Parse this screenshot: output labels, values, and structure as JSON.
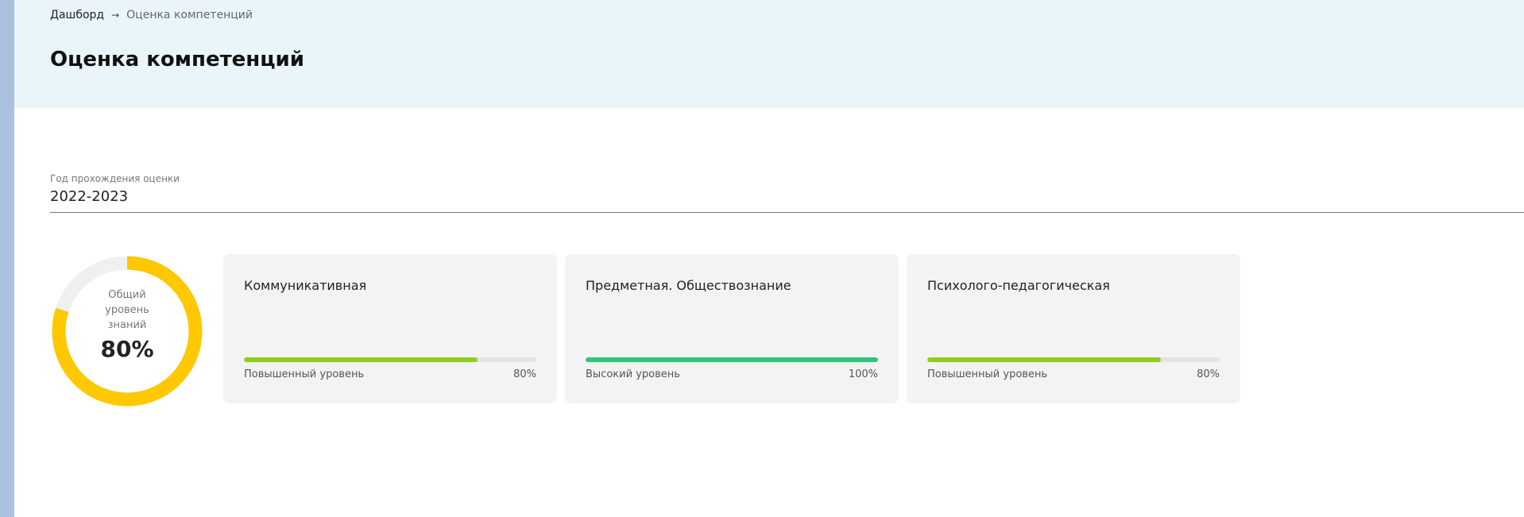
{
  "breadcrumb": {
    "home": "Дашборд",
    "separator": "→",
    "current": "Оценка компетенций"
  },
  "page_title": "Оценка компетенций",
  "year_field": {
    "label": "Год прохождения оценки",
    "value": "2022-2023"
  },
  "overall": {
    "label_line1": "Общий",
    "label_line2": "уровень",
    "label_line3": "знаний",
    "value_text": "80%",
    "progress": 0.8,
    "color": "#ffc800",
    "track_color": "#f0f0f0"
  },
  "cards": [
    {
      "title": "Коммуникативная",
      "level": "Повышенный уровень",
      "percent_text": "80%",
      "progress": 0.8,
      "bar_color": "#8ecf1c"
    },
    {
      "title": "Предметная. Обществознание",
      "level": "Высокий уровень",
      "percent_text": "100%",
      "progress": 1.0,
      "bar_color": "#2ec47a"
    },
    {
      "title": "Психолого-педагогическая",
      "level": "Повышенный уровень",
      "percent_text": "80%",
      "progress": 0.8,
      "bar_color": "#8ecf1c"
    }
  ]
}
